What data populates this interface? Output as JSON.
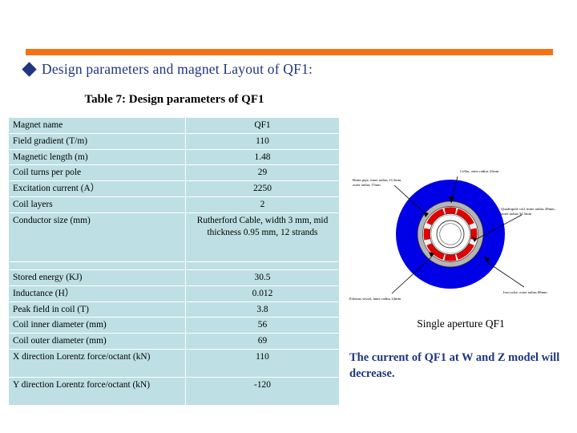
{
  "slide": {
    "accent_color": "#F47216",
    "heading_color": "#1F3580",
    "bullet_icon": "diamond-bullet",
    "heading": "Design parameters and magnet Layout of QF1:"
  },
  "table": {
    "caption": "Table 7: Design parameters of QF1",
    "cell_color": "#BEDFE3",
    "rows_top": [
      {
        "label": "Magnet name",
        "value": "QF1"
      },
      {
        "label": "Field gradient (T/m)",
        "value": "110"
      },
      {
        "label": "Magnetic length (m)",
        "value": "1.48"
      },
      {
        "label": "Coil turns per pole",
        "value": "29"
      },
      {
        "label": "Excitation current (A）",
        "value": "2250"
      },
      {
        "label": "Coil layers",
        "value": "2"
      },
      {
        "label": "Conductor size (mm)",
        "value": "Rutherford Cable, width 3 mm, mid thickness 0.95 mm, 12 strands"
      }
    ],
    "rows_bottom": [
      {
        "label": "Stored energy (KJ)",
        "value": "30.5"
      },
      {
        "label": "Inductance (H）",
        "value": "0.012"
      },
      {
        "label": "Peak field in coil (T)",
        "value": "3.8"
      },
      {
        "label": "Coil inner diameter (mm)",
        "value": "56"
      },
      {
        "label": "Coil outer diameter (mm)",
        "value": "69"
      },
      {
        "label": "X direction Lorentz force/octant (kN)",
        "value": "110"
      },
      {
        "label": "Y direction Lorentz force/octant (kN)",
        "value": "-120"
      }
    ]
  },
  "figure": {
    "caption": "Single aperture QF1",
    "yoke_color": "#0000E6",
    "coil_color": "#E10000",
    "collar_color": "#B4B4B4",
    "callouts": {
      "collar": "Collar, outer radius 41mm",
      "beam_pipe": "Beam pipe, inner radius 13.3mm, outer radius 17mm",
      "quadrupole_coil": "Quadrupole coil, inner radius 28mm, outer radius 34.5mm",
      "exhaust_vessel": "Exhaust vessel, inner radius 24mm",
      "iron_yoke": "Iron yoke, outer radius 68mm"
    }
  },
  "note": {
    "text": "The current of QF1 at W and Z model will decrease."
  }
}
